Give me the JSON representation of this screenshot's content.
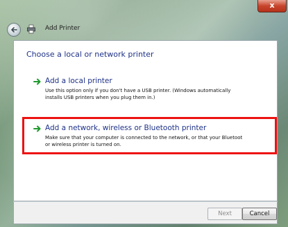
{
  "window": {
    "title": "Add Printer",
    "close_label": "x"
  },
  "main": {
    "heading": "Choose a local or network printer",
    "options": [
      {
        "title": "Add a local printer",
        "description_lines": [
          "Use this option only if you don't have a USB printer. (Windows automatically",
          "installs USB printers when you plug them in.)"
        ]
      },
      {
        "title": "Add a network, wireless or Bluetooth printer",
        "description_lines": [
          "Make sure that your computer is connected to the network, or that your Bluetoot",
          "or wireless printer is turned on."
        ]
      }
    ]
  },
  "footer": {
    "next_label": "Next",
    "cancel_label": "Cancel"
  },
  "colors": {
    "heading_blue": "#1e3287",
    "arrow_green": "#1f9a2e",
    "highlight_red": "#ee1111"
  },
  "icons": {
    "back": "back-arrow-icon",
    "title": "printer-icon",
    "option": "green-arrow-icon"
  },
  "state": {
    "next_enabled": false
  }
}
